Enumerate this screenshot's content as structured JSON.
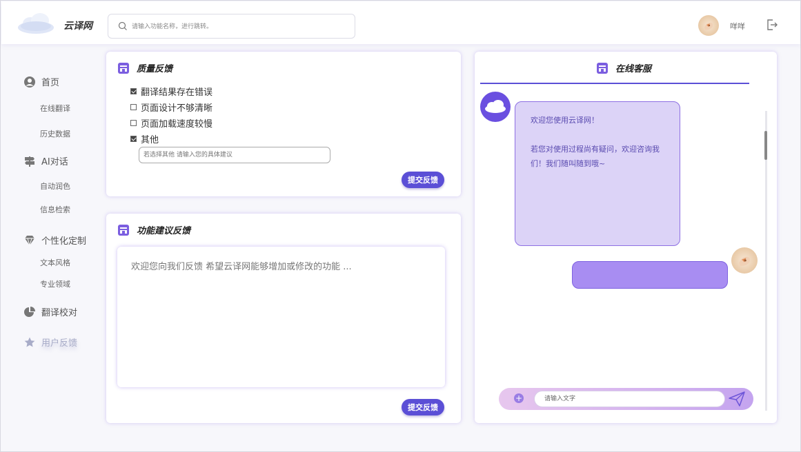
{
  "header": {
    "brand": "云译网",
    "search_placeholder": "请输入功能名称，进行跳转。",
    "username": "咩咩"
  },
  "sidebar": {
    "items": [
      {
        "label": "首页",
        "icon": "user-circle-icon",
        "type": "main"
      },
      {
        "label": "在线翻译",
        "type": "sub"
      },
      {
        "label": "历史数据",
        "type": "sub"
      },
      {
        "label": "AI对话",
        "icon": "signpost-icon",
        "type": "main"
      },
      {
        "label": "自动润色",
        "type": "sub"
      },
      {
        "label": "信息检索",
        "type": "sub"
      },
      {
        "label": "个性化定制",
        "icon": "diamond-icon",
        "type": "main"
      },
      {
        "label": "文本风格",
        "type": "sub"
      },
      {
        "label": "专业领域",
        "type": "sub"
      },
      {
        "label": "翻译校对",
        "icon": "pie-chart-icon",
        "type": "main"
      },
      {
        "label": "用户反馈",
        "icon": "star-icon",
        "type": "main",
        "active": true
      }
    ]
  },
  "quality": {
    "title": "质量反馈",
    "options": [
      {
        "label": "翻译结果存在错误",
        "checked": true
      },
      {
        "label": "页面设计不够清晰",
        "checked": false
      },
      {
        "label": "页面加载速度较慢",
        "checked": false
      },
      {
        "label": "其他",
        "checked": true
      }
    ],
    "other_placeholder": "若选择其他 请输入您的具体建议",
    "submit_label": "提交反馈"
  },
  "suggestion": {
    "title": "功能建议反馈",
    "placeholder": "欢迎您向我们反馈 希望云译网能够增加或修改的功能 ...",
    "submit_label": "提交反馈"
  },
  "chat": {
    "title": "在线客服",
    "bot_message_line1": "欢迎您使用云译网！",
    "bot_message_line2": "若您对使用过程尚有疑问，欢迎咨询我们！我们随叫随到哦~",
    "user_message": "",
    "input_placeholder": "请输入文字"
  },
  "colors": {
    "accent": "#5b4fd6",
    "bot_bubble": "#dcd3f7",
    "user_bubble": "#a88df2"
  }
}
